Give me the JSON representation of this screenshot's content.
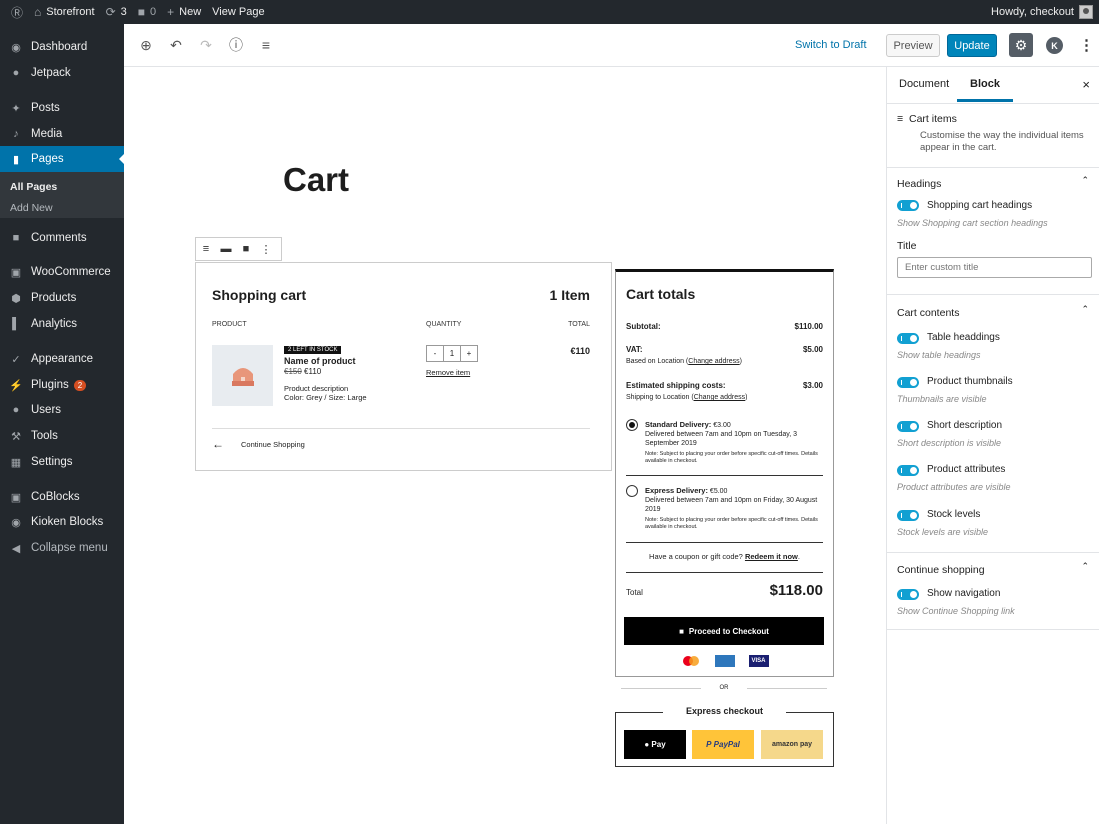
{
  "admin_bar": {
    "site": "Storefront",
    "updates": "3",
    "comments": "0",
    "new": "New",
    "view": "View Page",
    "howdy": "Howdy, checkout"
  },
  "sidebar": {
    "items": [
      {
        "label": "Dashboard",
        "icon": "dashboard-icon"
      },
      {
        "label": "Jetpack",
        "icon": "jetpack-icon"
      },
      {
        "label": "Posts",
        "icon": "pin-icon"
      },
      {
        "label": "Media",
        "icon": "media-icon"
      },
      {
        "label": "Pages",
        "icon": "page-icon"
      },
      {
        "label": "Comments",
        "icon": "comment-icon"
      },
      {
        "label": "WooCommerce",
        "icon": "woo-icon"
      },
      {
        "label": "Products",
        "icon": "archive-icon"
      },
      {
        "label": "Analytics",
        "icon": "bar-chart-icon"
      },
      {
        "label": "Appearance",
        "icon": "brush-icon"
      },
      {
        "label": "Plugins",
        "icon": "plug-icon"
      },
      {
        "label": "Users",
        "icon": "user-icon"
      },
      {
        "label": "Tools",
        "icon": "wrench-icon"
      },
      {
        "label": "Settings",
        "icon": "settings-icon"
      },
      {
        "label": "CoBlocks",
        "icon": "coblocks-icon"
      },
      {
        "label": "Kioken Blocks",
        "icon": "kioken-icon"
      },
      {
        "label": "Collapse menu",
        "icon": "collapse-icon"
      }
    ],
    "plugins_badge": "2",
    "sub": {
      "all_pages": "All Pages",
      "add_new": "Add New"
    }
  },
  "toolbar": {
    "switch_draft": "Switch to Draft",
    "preview": "Preview",
    "update": "Update",
    "k": "K"
  },
  "page": {
    "title": "Cart"
  },
  "cart": {
    "heading": "Shopping cart",
    "count": "1 Item",
    "headers": {
      "product": "PRODUCT",
      "quantity": "QUANTITY",
      "total": "TOTAL"
    },
    "item": {
      "stock": "2 LEFT IN STOCK",
      "name": "Name of product",
      "old_price": "€150",
      "price": "€110",
      "desc": "Product description",
      "attrs": "Color: Grey  /  Size: Large",
      "qty": "1",
      "minus": "-",
      "plus": "+",
      "remove": "Remove item",
      "total": "€110"
    },
    "continue": "Continue Shopping"
  },
  "totals": {
    "heading": "Cart totals",
    "subtotal_label": "Subtotal:",
    "subtotal": "$110.00",
    "vat_label": "VAT:",
    "vat": "$5.00",
    "vat_note": "Based on Location (",
    "vat_link": "Change address",
    "close": ")",
    "ship_label": "Estimated shipping costs:",
    "ship": "$3.00",
    "ship_note": "Shipping to Location (",
    "std_title": "Standard Delivery:",
    "std_price": "€3.00",
    "std_desc": "Delivered between 7am and 10pm on Tuesday, 3 September 2019",
    "note": "Note: Subject to placing your order before specific cut-off times. Details available in checkout.",
    "exp_title": "Express Delivery:",
    "exp_price": "€5.00",
    "exp_desc": "Delivered between 7am and 10pm on Friday, 30 August 2019",
    "coupon": "Have a coupon or gift code?",
    "redeem": "Redeem it now",
    "total_label": "Total",
    "total": "$118.00",
    "checkout": "Proceed to Checkout",
    "visa": "VISA"
  },
  "or": "OR",
  "express": {
    "heading": "Express checkout",
    "apple": "Pay",
    "paypal": "PayPal",
    "amazon": "amazon pay"
  },
  "panel": {
    "tab_document": "Document",
    "tab_block": "Block",
    "block_name": "Cart items",
    "block_desc": "Customise the way the individual items appear in the cart.",
    "headings_section": "Headings",
    "shopping_headings": "Shopping cart headings",
    "shopping_headings_help": "Show Shopping cart section headings",
    "title_label": "Title",
    "title_placeholder": "Enter custom title",
    "cart_contents": "Cart contents",
    "toggles": [
      {
        "label": "Table headdings",
        "help": "Show table headings"
      },
      {
        "label": "Product thumbnails",
        "help": "Thumbnails are visible"
      },
      {
        "label": "Short description",
        "help": "Short description is visible"
      },
      {
        "label": "Product attributes",
        "help": "Product attributes are visible"
      },
      {
        "label": "Stock levels",
        "help": "Stock levels are visible"
      }
    ],
    "continue_section": "Continue shopping",
    "show_nav": "Show navigation",
    "show_nav_help": "Show Continue Shopping link"
  },
  "colors": {
    "admin_bg": "#23282d",
    "accent": "#0073aa",
    "toggle": "#11a0d2",
    "update": "#0085ba"
  }
}
